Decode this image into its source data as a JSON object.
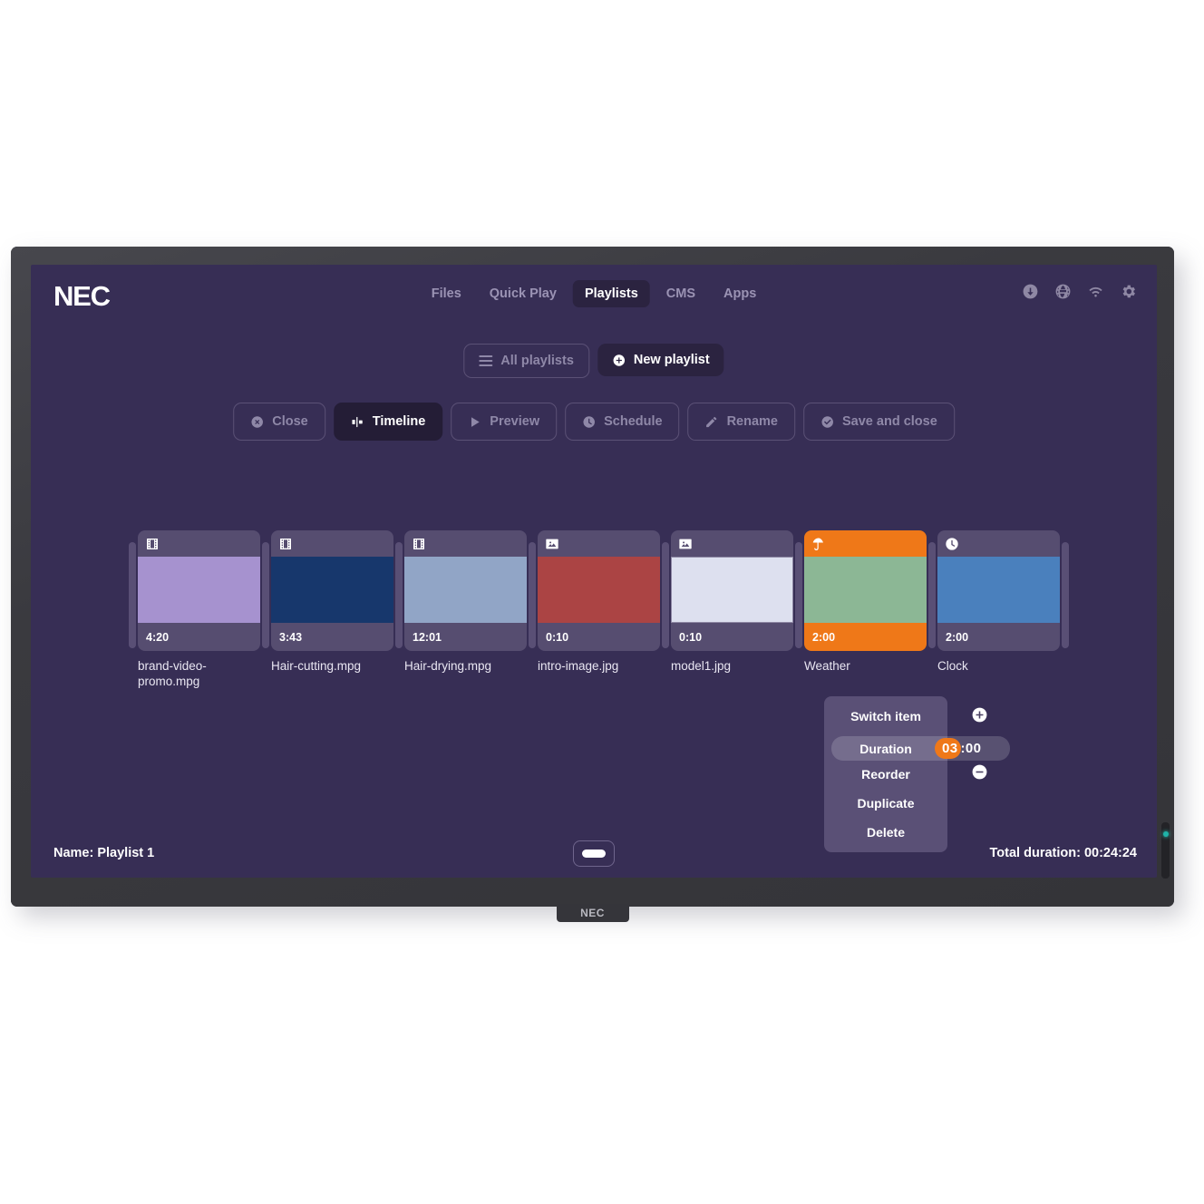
{
  "device": {
    "brand_logo": "NEC",
    "bezel_logo": "NEC"
  },
  "header": {
    "logo": "NEC",
    "nav": [
      {
        "label": "Files",
        "active": false
      },
      {
        "label": "Quick Play",
        "active": false
      },
      {
        "label": "Playlists",
        "active": true
      },
      {
        "label": "CMS",
        "active": false
      },
      {
        "label": "Apps",
        "active": false
      }
    ],
    "status_icons": [
      {
        "name": "download-icon"
      },
      {
        "name": "globe-icon"
      },
      {
        "name": "wifi-icon"
      },
      {
        "name": "gear-icon"
      }
    ]
  },
  "playlist_controls": {
    "all_playlists": "All playlists",
    "new_playlist": "New playlist"
  },
  "toolbar": {
    "close": "Close",
    "timeline": "Timeline",
    "preview": "Preview",
    "schedule": "Schedule",
    "rename": "Rename",
    "save_and_close": "Save and close"
  },
  "timeline": {
    "items": [
      {
        "label": "brand-video-promo.mpg",
        "duration": "4:20",
        "icon": "film-icon",
        "media_color": "#a692cf",
        "selected": false,
        "bordered": false
      },
      {
        "label": "Hair-cutting.mpg",
        "duration": "3:43",
        "icon": "film-icon",
        "media_color": "#17376c",
        "selected": false,
        "bordered": false
      },
      {
        "label": "Hair-drying.mpg",
        "duration": "12:01",
        "icon": "film-icon",
        "media_color": "#91a5c6",
        "selected": false,
        "bordered": false
      },
      {
        "label": "intro-image.jpg",
        "duration": "0:10",
        "icon": "image-icon",
        "media_color": "#ab4444",
        "selected": false,
        "bordered": false
      },
      {
        "label": "model1.jpg",
        "duration": "0:10",
        "icon": "image-icon",
        "media_color": "#dde0ef",
        "selected": false,
        "bordered": true
      },
      {
        "label": "Weather",
        "duration": "2:00",
        "icon": "umbrella-icon",
        "media_color": "#8cb795",
        "selected": true,
        "bordered": false
      },
      {
        "label": "Clock",
        "duration": "2:00",
        "icon": "clock-icon",
        "media_color": "#4a80bd",
        "selected": false,
        "bordered": false
      }
    ]
  },
  "context_menu": {
    "items": [
      "Switch item",
      "Duration",
      "Reorder",
      "Duplicate",
      "Delete"
    ],
    "switch_item": "Switch item",
    "duration_label": "Duration",
    "duration_value_highlight": "03",
    "duration_value_rest": ":00",
    "reorder": "Reorder",
    "duplicate": "Duplicate",
    "delete": "Delete",
    "increase_icon": "plus-circle-icon",
    "decrease_icon": "minus-circle-icon"
  },
  "footer": {
    "name": "Name: Playlist 1",
    "total_duration": "Total duration: 00:24:24"
  },
  "colors": {
    "screen_background": "#372e55",
    "accent_orange": "#ef7818",
    "card_background": "#564d70",
    "handle": "#594f75",
    "nav_inactive": "#9b93b4",
    "led": "#1fb3a8"
  }
}
